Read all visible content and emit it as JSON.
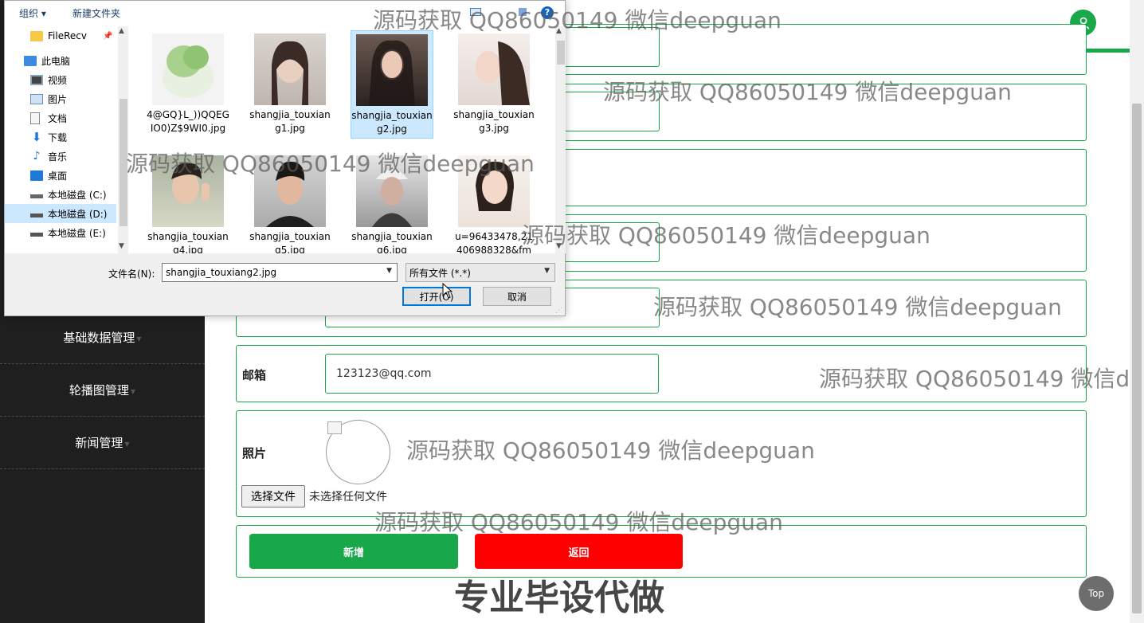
{
  "sidebar": {
    "items": [
      {
        "label": "基础数据管理"
      },
      {
        "label": "轮播图管理"
      },
      {
        "label": "新闻管理"
      }
    ]
  },
  "header": {
    "avatar_icon": "user-icon"
  },
  "form": {
    "email_label": "邮箱",
    "email_value": "123123@qq.com",
    "photo_label": "照片",
    "file_button": "选择文件",
    "file_status": "未选择任何文件",
    "submit_label": "新增",
    "back_label": "返回"
  },
  "top_button": "Top",
  "watermark": {
    "text": "源码获取 QQ86050149 微信deepguan",
    "text_cut": "源码获取 QQ86050149 微信d",
    "big": "专业毕设代做"
  },
  "dialog": {
    "organize": "组织",
    "new_folder": "新建文件夹",
    "tree": [
      {
        "label": "FileRecv",
        "icon": "folder-icon"
      },
      {
        "label": "此电脑",
        "icon": "computer-icon"
      },
      {
        "label": "视频",
        "icon": "video-icon"
      },
      {
        "label": "图片",
        "icon": "pictures-icon"
      },
      {
        "label": "文档",
        "icon": "documents-icon"
      },
      {
        "label": "下载",
        "icon": "download-icon"
      },
      {
        "label": "音乐",
        "icon": "music-icon"
      },
      {
        "label": "桌面",
        "icon": "desktop-icon"
      },
      {
        "label": "本地磁盘 (C:)",
        "icon": "drive-icon"
      },
      {
        "label": "本地磁盘 (D:)",
        "icon": "drive-icon"
      },
      {
        "label": "本地磁盘 (E:)",
        "icon": "drive-icon"
      }
    ],
    "files": [
      {
        "name": "4@GQ}L_))QQEGIO0)Z$9WI0.jpg"
      },
      {
        "name": "shangjia_touxiang1.jpg"
      },
      {
        "name": "shangjia_touxiang2.jpg"
      },
      {
        "name": "shangjia_touxiang3.jpg"
      },
      {
        "name": "shangjia_touxiang4.jpg"
      },
      {
        "name": "shangjia_touxiang5.jpg"
      },
      {
        "name": "shangjia_touxiang6.jpg"
      },
      {
        "name": "u=96433478,21406988328&fm="
      }
    ],
    "filename_label": "文件名(N):",
    "filename_value": "shangjia_touxiang2.jpg",
    "filetype_value": "所有文件 (*.*)",
    "open_label": "打开(O)",
    "cancel_label": "取消"
  }
}
